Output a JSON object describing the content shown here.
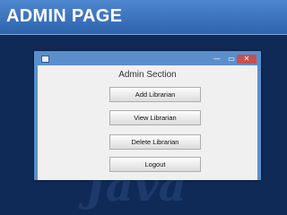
{
  "slide": {
    "title": "ADMIN PAGE",
    "watermark": "Java"
  },
  "window": {
    "controls": {
      "minimize": "—",
      "maximize": "▭",
      "close": "✕"
    },
    "heading": "Admin Section",
    "buttons": {
      "add_librarian": "Add Librarian",
      "view_librarian": "View Librarian",
      "delete_librarian": "Delete Librarian",
      "logout": "Logout"
    }
  },
  "colors": {
    "slide_background": "#0f2a57",
    "title_bar": "#3b73bd",
    "window_border": "#5b8fcb",
    "close_button": "#c75050"
  }
}
